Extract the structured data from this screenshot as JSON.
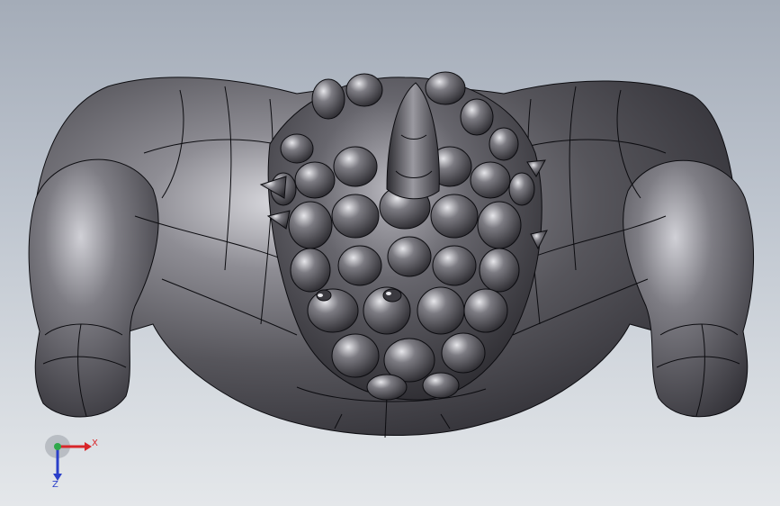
{
  "viewport": {
    "background_top": "#a4acb8",
    "background_bottom": "#e4e7ea",
    "model_color": "#58575c",
    "edge_color": "#0c0c10"
  },
  "model": {
    "icon": "creature-model-icon"
  },
  "triad": {
    "x_label": "X",
    "z_label": "Z",
    "x_color": "#d8262a",
    "y_color": "#2fa84a",
    "z_color": "#2a3fc9"
  }
}
